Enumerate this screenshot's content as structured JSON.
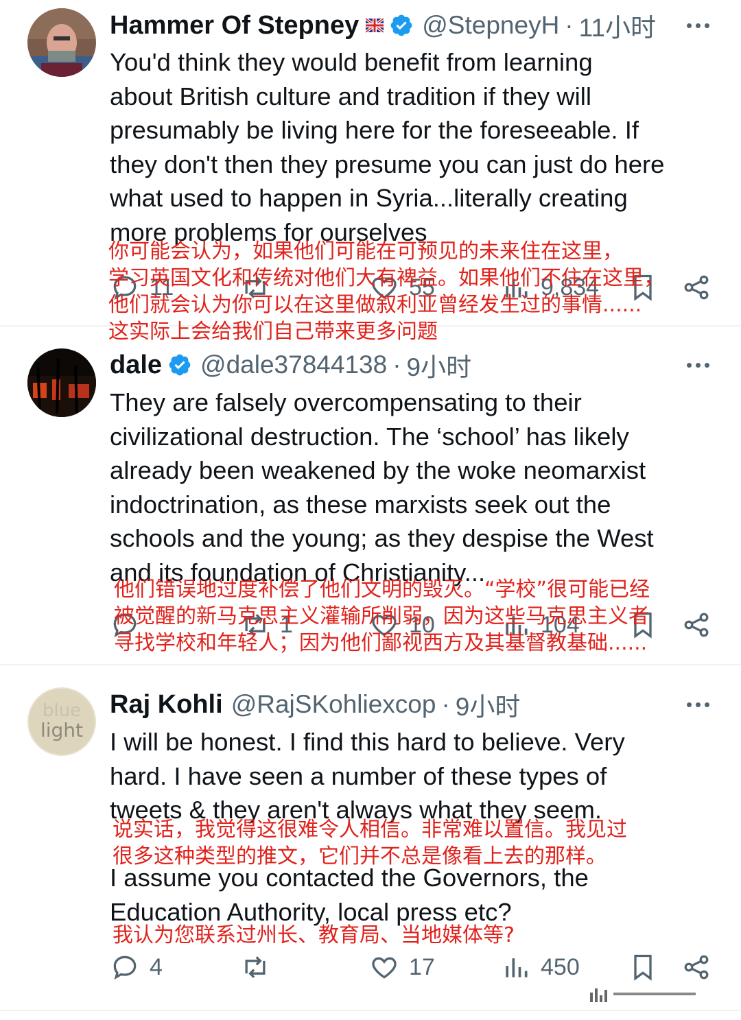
{
  "tweets": [
    {
      "name": "Hammer Of Stepney",
      "handle": "@StepneyH",
      "time": "11小时",
      "text": "You'd think they would benefit from learning\nabout British culture and tradition if they will\npresumably be living here for the foreseeable. If\nthey don't then they presume you can just do here\nwhat used to happen in Syria...literally creating\nmore problems for ourselves",
      "translation": "你可能会认为，如果他们可能在可预见的未来住在这里，\n学习英国文化和传统对他们大有裨益。如果他们不住在这里，\n他们就会认为你可以在这里做叙利亚曾经发生过的事情......\n这实际上会给我们自己带来更多问题",
      "replies": "11",
      "retweets": "",
      "likes": "55",
      "views": "9,834"
    },
    {
      "name": "dale",
      "handle": "@dale37844138",
      "time": "9小时",
      "text": "They are falsely overcompensating to their\ncivilizational destruction. The ‘school’ has likely\nalready been weakened by the woke neomarxist\nindoctrination, as these marxists seek out the\nschools and the young; as they despise the West\nand its foundation of Christianity...",
      "translation": "他们错误地过度补偿了他们文明的毁灭。“学校”很可能已经\n被觉醒的新马克思主义灌输所削弱，因为这些马克思主义者\n寻找学校和年轻人；因为他们鄙视西方及其基督教基础......",
      "replies": "",
      "retweets": "1",
      "likes": "10",
      "views": "104"
    },
    {
      "name": "Raj Kohli",
      "handle": "@RajSKohliexcop",
      "time": "9小时",
      "text_1": "I will be honest.  I find this hard to believe. Very\nhard. I have seen a number of these types of\ntweets & they aren't always what they seem.",
      "translation_1": "说实话，我觉得这很难令人相信。非常难以置信。我见过\n很多这种类型的推文，它们并不总是像看上去的那样。",
      "text_2": "I assume you contacted the Governors,  the\nEducation Authority,  local press etc?",
      "translation_2": "我认为您联系过州长、教育局、当地媒体等?",
      "avatar_text_1": "blue",
      "avatar_text_2": "light",
      "replies": "4",
      "retweets": "",
      "likes": "17",
      "views": "450"
    }
  ],
  "dot": "·",
  "icons": [
    "reply-icon",
    "retweet-icon",
    "like-icon",
    "views-icon",
    "bookmark-icon",
    "share-icon",
    "more-icon",
    "verified-badge-icon",
    "uk-flag-icon"
  ],
  "colors": {
    "verified": "#1d9bf0",
    "translation": "#e0231c",
    "secondary": "#536471",
    "text": "#0f1419"
  }
}
